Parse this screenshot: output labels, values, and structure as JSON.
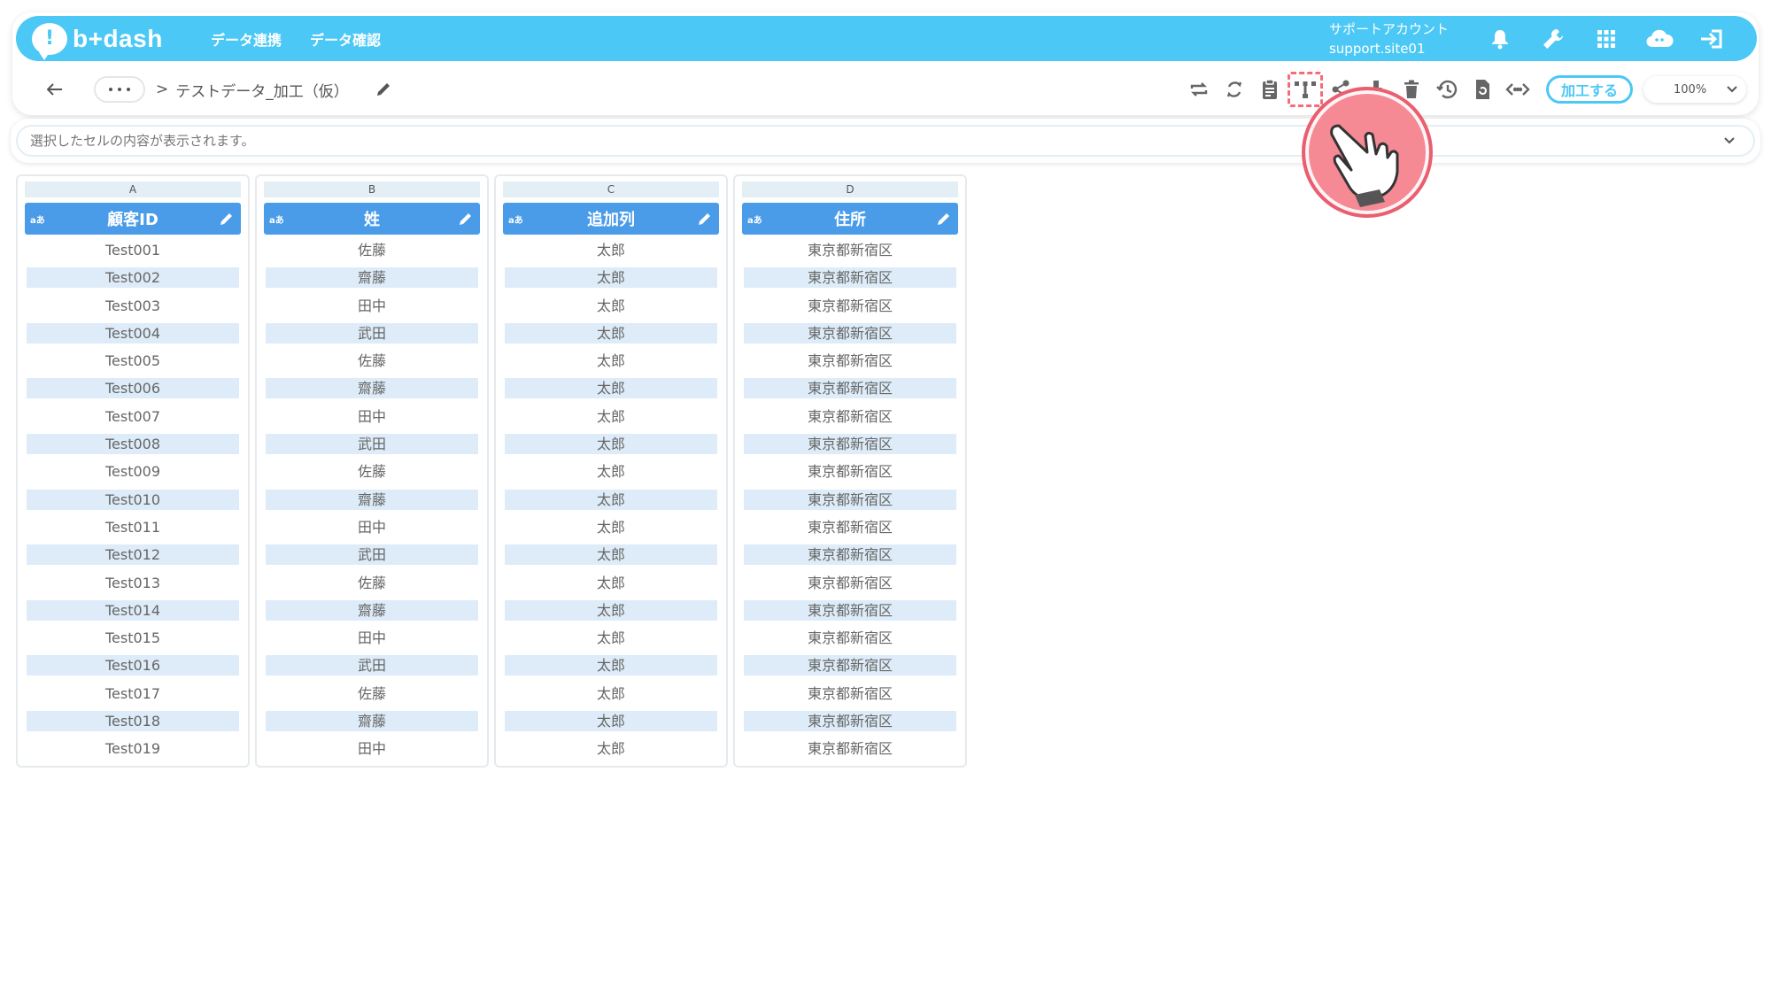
{
  "header": {
    "logo_text": "b+dash",
    "nav_links": [
      "データ連携",
      "データ確認"
    ],
    "account_name": "サポートアカウント",
    "account_id": "support.site01",
    "icons": [
      "bell-icon",
      "wrench-icon",
      "grid-icon",
      "cloud-icon",
      "logout-icon"
    ]
  },
  "breadcrumb": {
    "separator": ">",
    "title": "テストデータ_加工（仮）"
  },
  "toolbar": {
    "icons": [
      "loop-icon",
      "refresh-icon",
      "clipboard-icon",
      "column-split-icon",
      "share-icon",
      "download-icon",
      "delete-icon",
      "history-icon",
      "restore-icon",
      "code-icon"
    ],
    "highlighted_icon": "column-split-icon",
    "process_label": "加工する",
    "zoom": "100%"
  },
  "cellbar": {
    "placeholder": "選択したセルの内容が表示されます。"
  },
  "table": {
    "columns": [
      {
        "letter": "A",
        "type": "aあ",
        "name": "顧客ID",
        "cells": [
          "Test001",
          "Test002",
          "Test003",
          "Test004",
          "Test005",
          "Test006",
          "Test007",
          "Test008",
          "Test009",
          "Test010",
          "Test011",
          "Test012",
          "Test013",
          "Test014",
          "Test015",
          "Test016",
          "Test017",
          "Test018",
          "Test019"
        ]
      },
      {
        "letter": "B",
        "type": "aあ",
        "name": "姓",
        "cells": [
          "佐藤",
          "齋藤",
          "田中",
          "武田",
          "佐藤",
          "齋藤",
          "田中",
          "武田",
          "佐藤",
          "齋藤",
          "田中",
          "武田",
          "佐藤",
          "齋藤",
          "田中",
          "武田",
          "佐藤",
          "齋藤",
          "田中"
        ]
      },
      {
        "letter": "C",
        "type": "aあ",
        "name": "追加列",
        "cells": [
          "太郎",
          "太郎",
          "太郎",
          "太郎",
          "太郎",
          "太郎",
          "太郎",
          "太郎",
          "太郎",
          "太郎",
          "太郎",
          "太郎",
          "太郎",
          "太郎",
          "太郎",
          "太郎",
          "太郎",
          "太郎",
          "太郎"
        ]
      },
      {
        "letter": "D",
        "type": "aあ",
        "name": "住所",
        "cells": [
          "東京都新宿区",
          "東京都新宿区",
          "東京都新宿区",
          "東京都新宿区",
          "東京都新宿区",
          "東京都新宿区",
          "東京都新宿区",
          "東京都新宿区",
          "東京都新宿区",
          "東京都新宿区",
          "東京都新宿区",
          "東京都新宿区",
          "東京都新宿区",
          "東京都新宿区",
          "東京都新宿区",
          "東京都新宿区",
          "東京都新宿区",
          "東京都新宿区",
          "東京都新宿区"
        ]
      }
    ]
  },
  "colors": {
    "header_bg": "#4bc8f5",
    "column_header_bg": "#4a9ce8",
    "alt_row_bg": "#ddecf8",
    "highlight": "#f46c7a"
  }
}
